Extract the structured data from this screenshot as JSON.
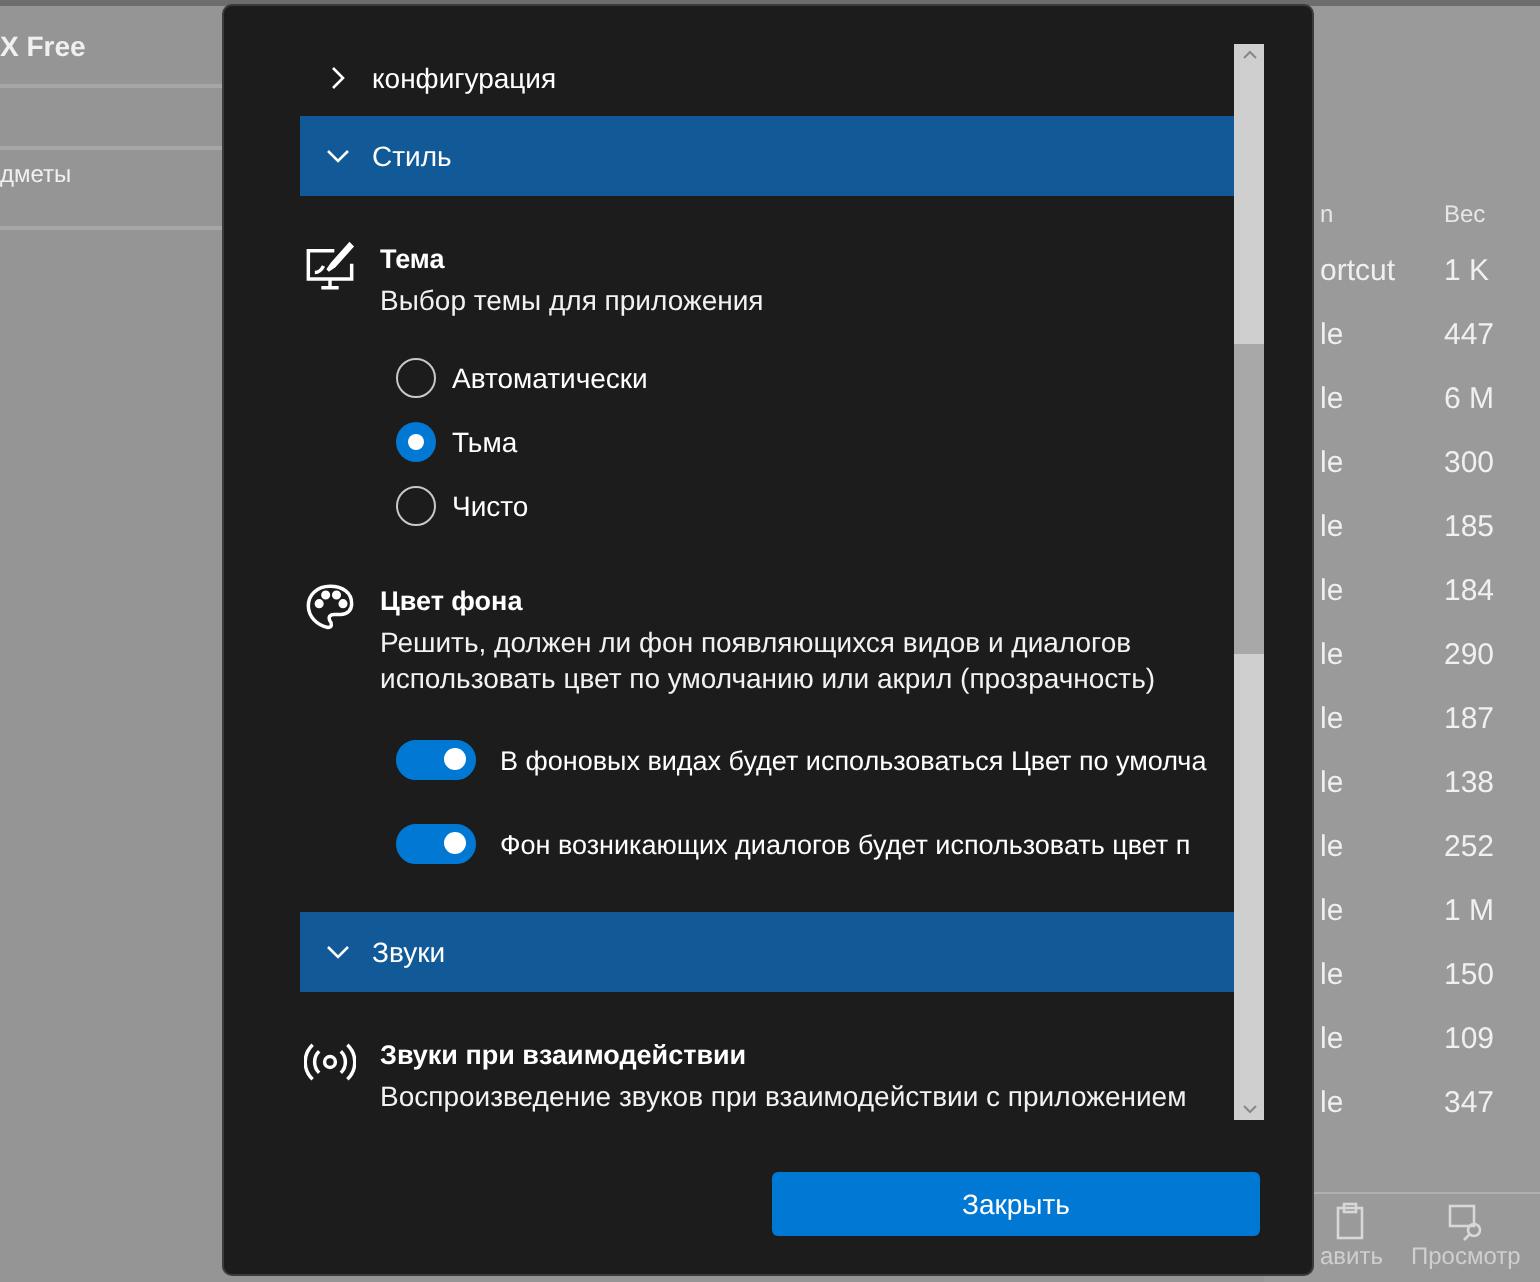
{
  "background_app": {
    "title": "X Free",
    "sidebar_item": "дметы",
    "columns": [
      "n",
      "Вес"
    ],
    "rows": [
      {
        "column_1": "ortcut",
        "size": "1 K"
      },
      {
        "column_1": "le",
        "size": "447"
      },
      {
        "column_1": "le",
        "size": "6 M"
      },
      {
        "column_1": "le",
        "size": "300"
      },
      {
        "column_1": "le",
        "size": "185"
      },
      {
        "column_1": "le",
        "size": "184"
      },
      {
        "column_1": "le",
        "size": "290"
      },
      {
        "column_1": "le",
        "size": "187"
      },
      {
        "column_1": "le",
        "size": "138"
      },
      {
        "column_1": "le",
        "size": "252"
      },
      {
        "column_1": "le",
        "size": "1 M"
      },
      {
        "column_1": "le",
        "size": "150"
      },
      {
        "column_1": "le",
        "size": "109"
      },
      {
        "column_1": "le",
        "size": "347"
      }
    ],
    "toolbar": [
      {
        "label": "авить"
      },
      {
        "label": "Просмотр"
      }
    ]
  },
  "dialog": {
    "sections": [
      {
        "title": "конфигурация",
        "expanded": false
      },
      {
        "title": "Стиль",
        "expanded": true,
        "settings": [
          {
            "kind": "radio",
            "title": "Тема",
            "description": "Выбор темы для приложения",
            "options": [
              {
                "label": "Автоматически",
                "selected": false
              },
              {
                "label": "Тьма",
                "selected": true
              },
              {
                "label": "Чисто",
                "selected": false
              }
            ]
          },
          {
            "kind": "toggles",
            "title": "Цвет фона",
            "description": "Решить, должен ли фон появляющихся видов и диалогов использовать цвет по умолчанию или акрил (прозрачность)",
            "toggles": [
              {
                "label": "В фоновых видах будет использоваться Цвет по умолча",
                "on": true
              },
              {
                "label": "Фон возникающих диалогов будет использовать цвет п",
                "on": true
              }
            ]
          }
        ]
      },
      {
        "title": "Звуки",
        "expanded": true,
        "settings": [
          {
            "kind": "sound",
            "title": "Звуки при взаимодействии",
            "description": "Воспроизведение звуков при взаимодействии с приложением"
          }
        ]
      }
    ],
    "close_button": "Закрыть"
  }
}
